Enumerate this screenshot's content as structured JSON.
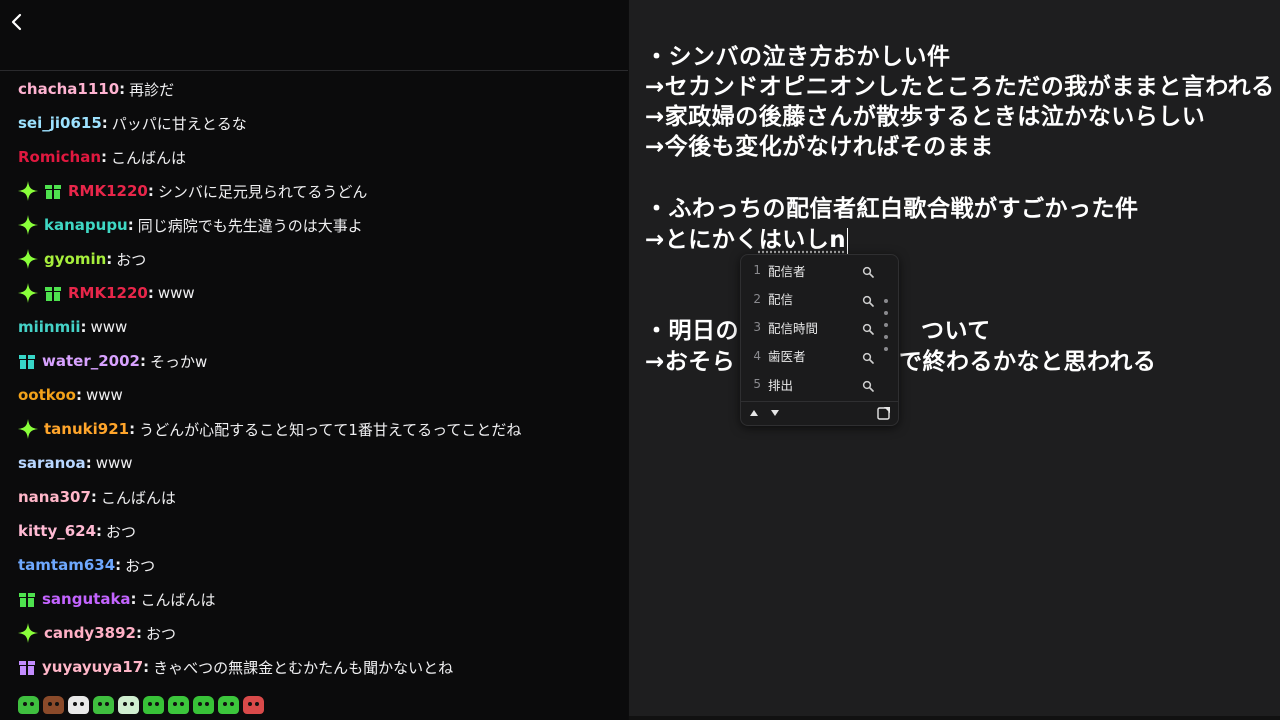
{
  "chat": {
    "messages": [
      {
        "user": "chacha1110",
        "color": "#ffb3d1",
        "badges": [],
        "text": "再診だ"
      },
      {
        "user": "sei_ji0615",
        "color": "#9de2ff",
        "badges": [],
        "text": "パッパに甘えとるな"
      },
      {
        "user": "Romichan",
        "color": "#e0183f",
        "badges": [],
        "text": "こんばんは"
      },
      {
        "user": "RMK1220",
        "color": "#e8264a",
        "badges": [
          "sparkle",
          "gift-green"
        ],
        "text": "シンバに足元見られてるうどん"
      },
      {
        "user": "kanapupu",
        "color": "#3fd8c4",
        "badges": [
          "sparkle"
        ],
        "text": "同じ病院でも先生違うのは大事よ"
      },
      {
        "user": "gyomin",
        "color": "#a7ef3c",
        "badges": [
          "sparkle"
        ],
        "text": "おつ"
      },
      {
        "user": "RMK1220",
        "color": "#e8264a",
        "badges": [
          "sparkle",
          "gift-green"
        ],
        "text": "www"
      },
      {
        "user": "miinmii",
        "color": "#45d2c7",
        "badges": [],
        "text": "www"
      },
      {
        "user": "water_2002",
        "color": "#d8a2ff",
        "badges": [
          "gift-teal"
        ],
        "text": "そっかw"
      },
      {
        "user": "ootkoo",
        "color": "#f2a21a",
        "badges": [],
        "text": "www"
      },
      {
        "user": "tanuki921",
        "color": "#ffa52b",
        "badges": [
          "sparkle"
        ],
        "text": "うどんが心配すること知ってて1番甘えてるってことだね"
      },
      {
        "user": "saranoa",
        "color": "#b8d6ff",
        "badges": [],
        "text": "www"
      },
      {
        "user": "nana307",
        "color": "#ffb6c8",
        "badges": [],
        "text": "こんばんは"
      },
      {
        "user": "kitty_624",
        "color": "#ffbad3",
        "badges": [],
        "text": "おつ"
      },
      {
        "user": "tamtam634",
        "color": "#6ea8ff",
        "badges": [],
        "text": "おつ"
      },
      {
        "user": "sangutaka",
        "color": "#c364ff",
        "badges": [
          "gift-green"
        ],
        "text": "こんばんは"
      },
      {
        "user": "candy3892",
        "color": "#ffb0c6",
        "badges": [
          "sparkle"
        ],
        "text": "おつ"
      },
      {
        "user": "yuyayuya17",
        "color": "#ffb6c8",
        "badges": [
          "gift-purple"
        ],
        "text": "きゃべつの無課金とむかたんも聞かないとね"
      }
    ],
    "emotes": [
      "green-emote",
      "brown-emote",
      "white-emote",
      "green-emote",
      "white-emote",
      "green-emote",
      "green-emote",
      "green-emote",
      "green-emote",
      "red-emote"
    ],
    "emote_colors": [
      "#3fbf3f",
      "#8a4a2a",
      "#e8e8e8",
      "#3fbf3f",
      "#cfeecf",
      "#38c238",
      "#3cc63c",
      "#38c238",
      "#3cc63c",
      "#d94a4a"
    ]
  },
  "notepad": {
    "lines": [
      "・シンバの泣き方おかしい件",
      "→セカンドオピニオンしたところただの我がままと言われる",
      "→家政婦の後藤さんが散歩するときは泣かないらしい",
      "→今後も変化がなければそのまま",
      "・ふわっちの配信者紅白歌合戦がすごかった件",
      "・明日の",
      "ついて",
      "→おそら",
      "で終わるかなと思われる"
    ],
    "composing_prefix": "→とにかく",
    "composing_text": "はいしn"
  },
  "ime": {
    "candidates": [
      {
        "num": "1",
        "text": "配信者"
      },
      {
        "num": "2",
        "text": "配信"
      },
      {
        "num": "3",
        "text": "配信時間"
      },
      {
        "num": "4",
        "text": "歯医者"
      },
      {
        "num": "5",
        "text": "排出"
      }
    ]
  },
  "colors": {
    "chat_bg": "#0b0b0c",
    "notepad_bg": "#1e1e1f",
    "badge_sparkle": "#8aff3a",
    "badge_gift_green": "#4ee24e",
    "badge_gift_teal": "#37d6c8",
    "badge_gift_purple": "#c38cff"
  }
}
